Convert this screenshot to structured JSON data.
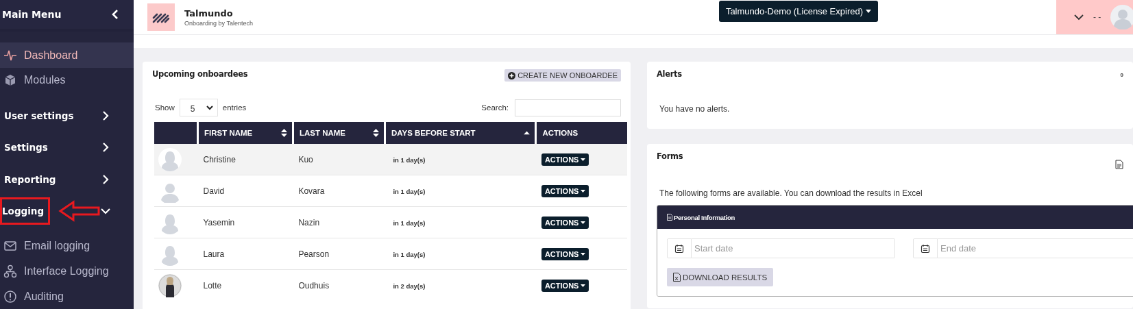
{
  "sidebar": {
    "title": "Main Menu",
    "items": [
      {
        "kind": "link",
        "label": "Dashboard",
        "selected": true
      },
      {
        "kind": "link",
        "label": "Modules",
        "selected": false
      },
      {
        "kind": "section",
        "label": "User settings",
        "expanded": false,
        "highlighted": false
      },
      {
        "kind": "section",
        "label": "Settings",
        "expanded": false,
        "highlighted": false
      },
      {
        "kind": "section",
        "label": "Reporting",
        "expanded": false,
        "highlighted": false
      },
      {
        "kind": "section",
        "label": "Logging",
        "expanded": true,
        "highlighted": true
      },
      {
        "kind": "link",
        "label": "Email logging",
        "selected": false
      },
      {
        "kind": "link",
        "label": "Interface Logging",
        "selected": false
      },
      {
        "kind": "link",
        "label": "Auditing",
        "selected": false
      }
    ]
  },
  "header": {
    "brand": {
      "name": "Talmundo",
      "tagline": "Onboarding by Talentech"
    },
    "account_menu": "Talmundo-Demo (License Expired)",
    "user_name": "- -"
  },
  "onboardees": {
    "title": "Upcoming onboardees",
    "create_button": "CREATE NEW ONBOARDEE",
    "length_label_before": "Show",
    "length_value": "5",
    "length_label_after": "entries",
    "search_label": "Search:",
    "columns": [
      {
        "kind": "plain"
      },
      {
        "label": "FIRST NAME",
        "kind": "sortable"
      },
      {
        "label": "LAST NAME",
        "kind": "sortable"
      },
      {
        "label": "DAYS BEFORE START",
        "kind": "ascending"
      },
      {
        "label": "ACTIONS",
        "kind": "plain"
      }
    ],
    "rows": [
      {
        "avatar": {
          "kind": "female"
        },
        "first_name": "Christine",
        "last_name": "Kuo",
        "days": "in 1 day(s)",
        "action": "ACTIONS",
        "hovered": true
      },
      {
        "avatar": {
          "kind": "male"
        },
        "first_name": "David",
        "last_name": "Kovara",
        "days": "in 1 day(s)",
        "action": "ACTIONS",
        "hovered": false
      },
      {
        "avatar": {
          "kind": "female"
        },
        "first_name": "Yasemin",
        "last_name": "Nazin",
        "days": "in 1 day(s)",
        "action": "ACTIONS",
        "hovered": false
      },
      {
        "avatar": {
          "kind": "female"
        },
        "first_name": "Laura",
        "last_name": "Pearson",
        "days": "in 1 day(s)",
        "action": "ACTIONS",
        "hovered": false
      },
      {
        "avatar": {
          "kind": "photo"
        },
        "first_name": "Lotte",
        "last_name": "Oudhuis",
        "days": "in 2 day(s)",
        "action": "ACTIONS",
        "hovered": false
      }
    ]
  },
  "alerts": {
    "title": "Alerts",
    "count": "0",
    "message": "You have no alerts."
  },
  "forms": {
    "title": "Forms",
    "intro": "The following forms are available. You can download the results in Excel",
    "form": {
      "title": "Personal Information",
      "start_placeholder": "Start date",
      "end_placeholder": "End date",
      "download_button": "DOWNLOAD RESULTS"
    }
  }
}
